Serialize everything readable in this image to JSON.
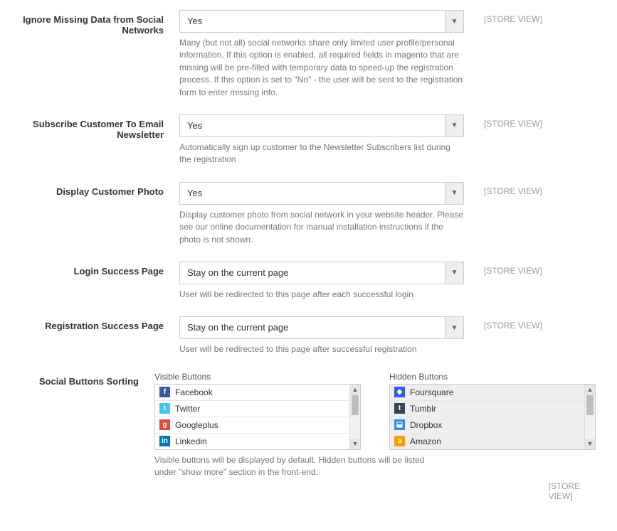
{
  "scope_label": "[STORE VIEW]",
  "fields": {
    "ignore_missing": {
      "label": "Ignore Missing Data from Social Networks",
      "value": "Yes",
      "help": "Many (but not all) social networks share only limited user profile/personal information. If this option is enabled, all required fields in magento that are missing will be pre-filled with temporary data to speed-up the registration process. If this option is set to \"No\" - the user will be sent to the registration form to enter missing info."
    },
    "subscribe_newsletter": {
      "label": "Subscribe Customer To Email Newsletter",
      "value": "Yes",
      "help": "Automatically sign up customer to the Newsletter Subscribers list during the registration"
    },
    "display_photo": {
      "label": "Display Customer Photo",
      "value": "Yes",
      "help": "Display customer photo from social network in your website header. Please see our online documentation for manual installation instructions if the photo is not shown."
    },
    "login_success": {
      "label": "Login Success Page",
      "value": "Stay on the current page",
      "help": "User will be redirected to this page after each successful login"
    },
    "registration_success": {
      "label": "Registration Success Page",
      "value": "Stay on the current page",
      "help": "User will be redirected to this page after successful registration"
    },
    "social_sorting": {
      "label": "Social Buttons Sorting",
      "visible_title": "Visible Buttons",
      "hidden_title": "Hidden Buttons",
      "visible": [
        {
          "name": "Facebook",
          "icon": "f",
          "color": "#3b5998"
        },
        {
          "name": "Twitter",
          "icon": "t",
          "color": "#45c4f2"
        },
        {
          "name": "Googleplus",
          "icon": "g",
          "color": "#dd4b39"
        },
        {
          "name": "Linkedin",
          "icon": "in",
          "color": "#0077b5"
        }
      ],
      "hidden": [
        {
          "name": "Foursquare",
          "icon": "◆",
          "color": "#2d5be3"
        },
        {
          "name": "Tumblr",
          "icon": "t",
          "color": "#35465c"
        },
        {
          "name": "Dropbox",
          "icon": "⬓",
          "color": "#2d8fe0"
        },
        {
          "name": "Amazon",
          "icon": "a",
          "color": "#ff9900"
        }
      ],
      "help": "Visible buttons will be displayed by default. Hidden buttons will be listed under \"show more\" section in the front-end."
    }
  }
}
